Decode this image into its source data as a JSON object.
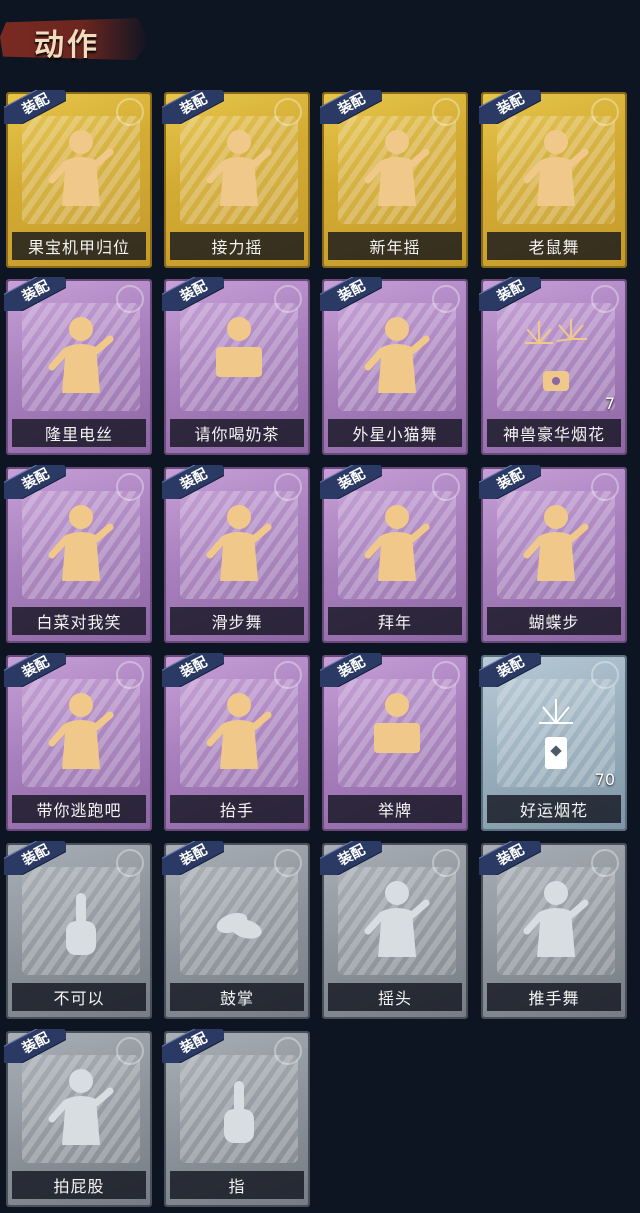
{
  "header": {
    "title": "动作"
  },
  "equip_tag": "装配",
  "colors": {
    "gold": "#d4ac34",
    "purple": "#a880bd",
    "blue": "#98aebc",
    "gray": "#8c939a",
    "equip_band": "#2b3a64",
    "background": "#0d1422"
  },
  "cards": [
    {
      "name": "果宝机甲归位",
      "rarity": "gold",
      "icon": "dance-figure-icon"
    },
    {
      "name": "接力摇",
      "rarity": "gold",
      "icon": "dance-figure-icon"
    },
    {
      "name": "新年摇",
      "rarity": "gold",
      "icon": "dance-figure-icon"
    },
    {
      "name": "老鼠舞",
      "rarity": "gold",
      "icon": "dance-figure-icon"
    },
    {
      "name": "隆里电丝",
      "rarity": "purple",
      "icon": "dance-figure-icon"
    },
    {
      "name": "请你喝奶茶",
      "rarity": "purple",
      "icon": "holding-sign-figure-icon"
    },
    {
      "name": "外星小猫舞",
      "rarity": "purple",
      "icon": "dance-figure-icon"
    },
    {
      "name": "神兽豪华烟花",
      "rarity": "purple",
      "icon": "fireworks-icon",
      "count": "7"
    },
    {
      "name": "白菜对我笑",
      "rarity": "purple",
      "icon": "dance-figure-icon"
    },
    {
      "name": "滑步舞",
      "rarity": "purple",
      "icon": "dance-figure-icon"
    },
    {
      "name": "拜年",
      "rarity": "purple",
      "icon": "bow-figure-icon"
    },
    {
      "name": "蝴蝶步",
      "rarity": "purple",
      "icon": "dance-figure-icon"
    },
    {
      "name": "带你逃跑吧",
      "rarity": "purple",
      "icon": "dance-figure-icon"
    },
    {
      "name": "抬手",
      "rarity": "purple",
      "icon": "raise-hand-figure-icon"
    },
    {
      "name": "举牌",
      "rarity": "purple",
      "icon": "holding-sign-figure-icon"
    },
    {
      "name": "好运烟花",
      "rarity": "blue",
      "icon": "firecracker-icon",
      "count": "70"
    },
    {
      "name": "不可以",
      "rarity": "gray",
      "icon": "finger-wag-icon"
    },
    {
      "name": "鼓掌",
      "rarity": "gray",
      "icon": "clapping-hands-icon"
    },
    {
      "name": "摇头",
      "rarity": "gray",
      "icon": "shake-head-figure-icon"
    },
    {
      "name": "推手舞",
      "rarity": "gray",
      "icon": "dance-figure-icon"
    },
    {
      "name": "拍屁股",
      "rarity": "gray",
      "icon": "dance-figure-icon"
    },
    {
      "name": "指",
      "rarity": "gray",
      "icon": "pointing-hand-icon"
    }
  ]
}
